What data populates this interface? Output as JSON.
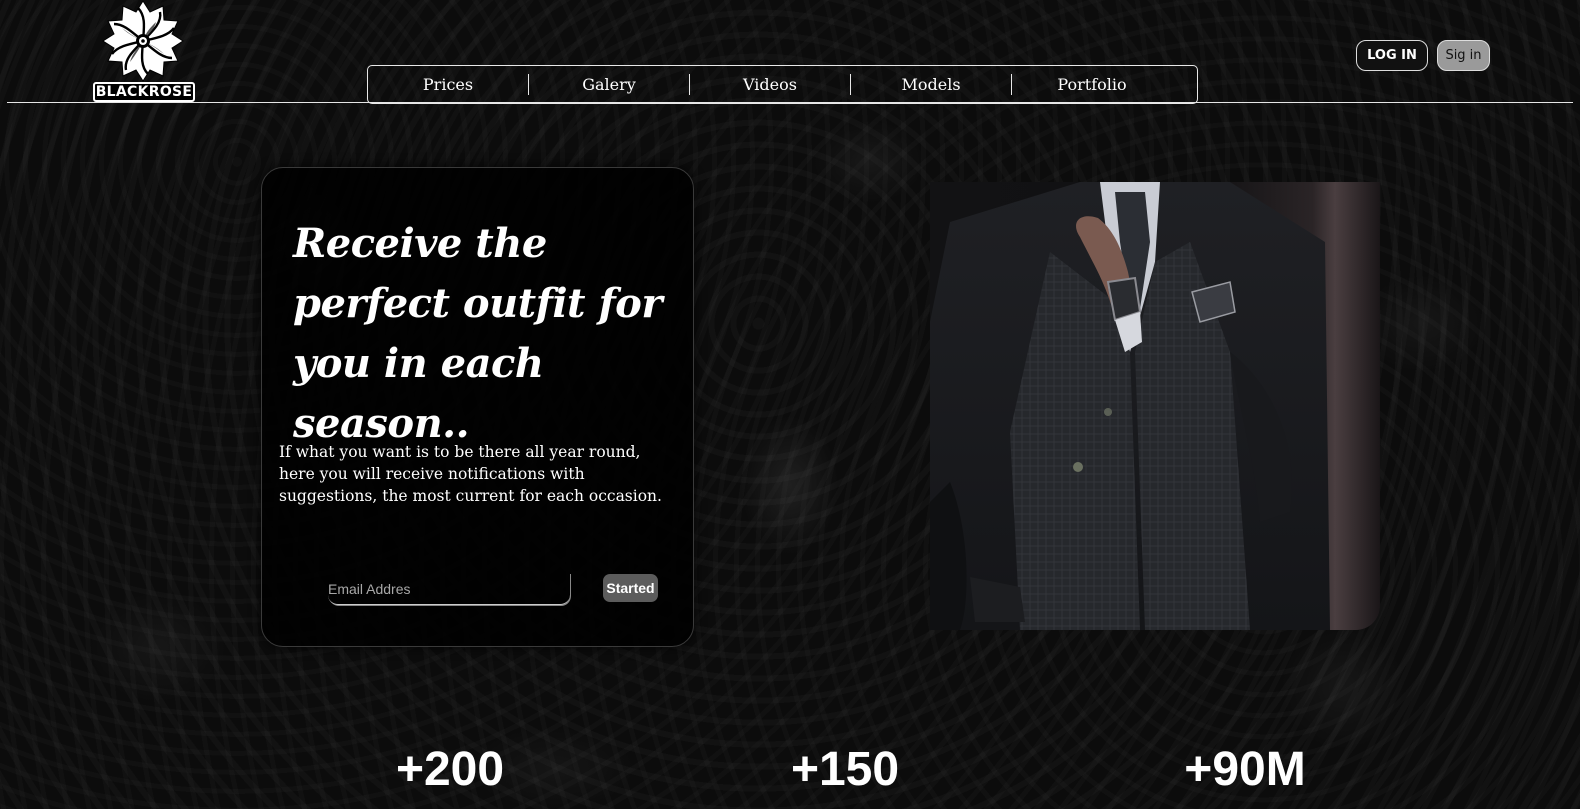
{
  "brand": {
    "name": "BLACKROSE",
    "logo_icon": "rose-mandala-icon"
  },
  "nav": {
    "items": [
      "Prices",
      "Galery",
      "Videos",
      "Models",
      "Portfolio"
    ]
  },
  "auth": {
    "login_label": "LOG IN",
    "signin_label": "Sig in"
  },
  "hero": {
    "headline": "Receive the perfect outfit for you in each season..",
    "description": "If what you want is to be there all year round, here you will receive notifications with suggestions, the most current for each occasion.",
    "email_placeholder": "Email Addres",
    "cta_label": "Started",
    "image_icon": "suited-man-photo"
  },
  "stats": [
    "+200",
    "+150",
    "+90M"
  ],
  "colors": {
    "background": "#0c0c0c",
    "text": "#ffffff",
    "signin_bg": "#9a9a9a",
    "cta_bg": "#5c5c5c"
  }
}
